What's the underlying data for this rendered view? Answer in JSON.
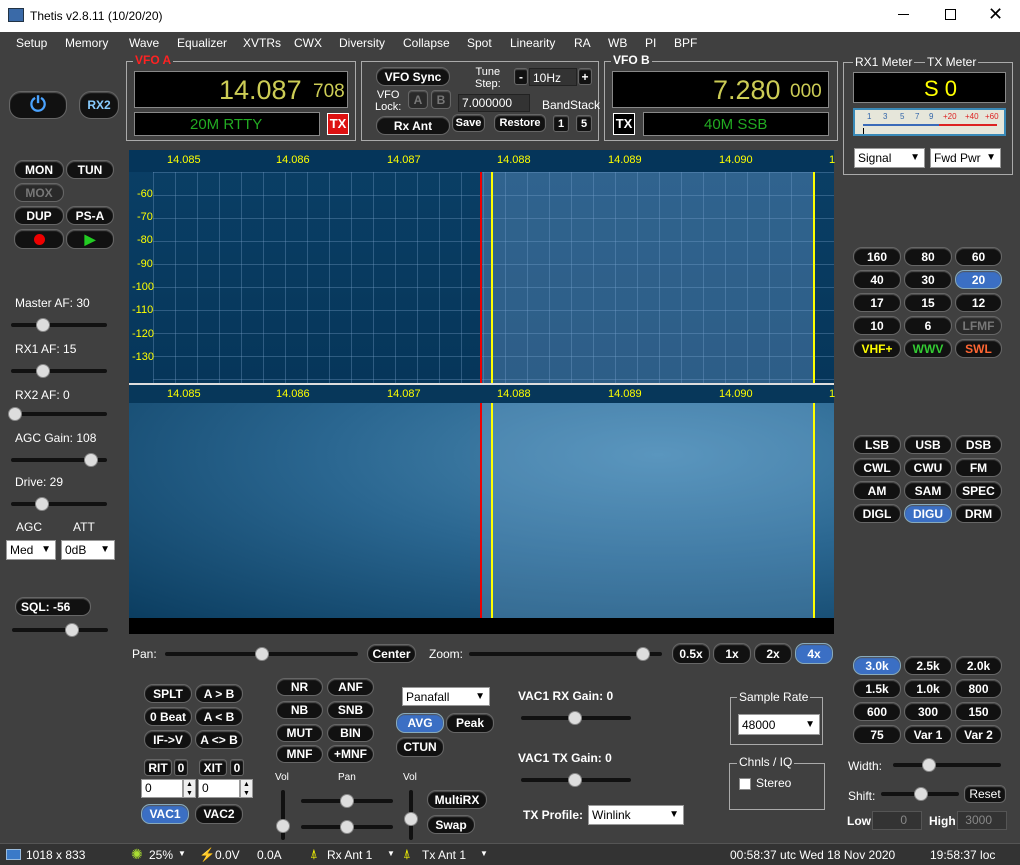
{
  "title": "Thetis v2.8.11 (10/20/20)",
  "menu": [
    "Setup",
    "Memory",
    "Wave",
    "Equalizer",
    "XVTRs",
    "CWX",
    "Diversity",
    "Collapse",
    "Spot",
    "Linearity",
    "RA",
    "WB",
    "PI",
    "BPF"
  ],
  "left": {
    "power_icon": "power-icon",
    "rx2": "RX2",
    "mon": "MON",
    "tun": "TUN",
    "mox": "MOX",
    "dup": "DUP",
    "psa": "PS-A",
    "record_icon": "record-icon",
    "play_icon": "play-icon",
    "master_af": "Master AF:  30",
    "rx1_af": "RX1 AF:  15",
    "rx2_af": "RX2 AF:  0",
    "agc_gain": "AGC Gain:  108",
    "drive": "Drive:  29",
    "agc_label": "AGC",
    "att_label": "ATT",
    "agc_value": "Med",
    "att_value": "0dB",
    "sql": "SQL: -56",
    "levels": {
      "master_af": 30,
      "rx1_af": 15,
      "rx2_af": 0,
      "agc_gain": 108,
      "drive": 29,
      "sql": -56
    }
  },
  "vfoa": {
    "label": "VFO A",
    "freq_main": "14.087",
    "freq_sub": "708",
    "mode": "20M RTTY",
    "tx": "TX"
  },
  "vfo_mid": {
    "vfo_sync": "VFO Sync",
    "tune_step_label": "Tune\nStep:",
    "tune_minus": "-",
    "tune_step": "10Hz",
    "tune_plus": "+",
    "vfo_lock": "VFO\nLock:",
    "lock_a": "A",
    "lock_b": "B",
    "bandstack_freq": "7.000000",
    "bandstack": "BandStack",
    "rx_ant": "Rx Ant",
    "save": "Save",
    "restore": "Restore",
    "bs1": "1",
    "bs5": "5"
  },
  "vfob": {
    "label": "VFO B",
    "freq_main": "7.280",
    "freq_sub": "000",
    "mode": "40M SSB",
    "tx": "TX"
  },
  "meters": {
    "rx1": "RX1 Meter",
    "tx": "TX Meter",
    "value": "S 0",
    "scale": [
      "1",
      "3",
      "5",
      "7",
      "9",
      "+20",
      "+40",
      "+60"
    ],
    "rx_mode": "Signal",
    "tx_mode": "Fwd Pwr"
  },
  "spectrum": {
    "freqs": [
      "14.085",
      "14.086",
      "14.087",
      "14.088",
      "14.089",
      "14.090",
      "1"
    ],
    "dbs": [
      "-60",
      "-70",
      "-80",
      "-90",
      "-100",
      "-110",
      "-120",
      "-130"
    ]
  },
  "pan": {
    "pan_label": "Pan:",
    "center": "Center",
    "zoom_label": "Zoom:",
    "zooms": [
      "0.5x",
      "1x",
      "2x",
      "4x"
    ]
  },
  "bands": [
    "160",
    "80",
    "60",
    "40",
    "30",
    "20",
    "17",
    "15",
    "12",
    "10",
    "6",
    "LFMF",
    "VHF+",
    "WWV",
    "SWL"
  ],
  "modes": [
    "LSB",
    "USB",
    "DSB",
    "CWL",
    "CWU",
    "FM",
    "AM",
    "SAM",
    "SPEC",
    "DIGL",
    "DIGU",
    "DRM"
  ],
  "filters": [
    "3.0k",
    "2.5k",
    "2.0k",
    "1.5k",
    "1.0k",
    "800",
    "600",
    "300",
    "150",
    "75",
    "Var 1",
    "Var 2"
  ],
  "filter_ctrl": {
    "width": "Width:",
    "shift": "Shift:",
    "reset": "Reset",
    "low": "Low",
    "low_val": "0",
    "high": "High",
    "high_val": "3000"
  },
  "bottom": {
    "splt": "SPLT",
    "a_to_b": "A > B",
    "zero_beat": "0 Beat",
    "a_from_b": "A < B",
    "if_v": "IF->V",
    "a_swap_b": "A <> B",
    "rit": "RIT",
    "rit_val": "0",
    "xit": "XIT",
    "xit_val": "0",
    "rit_input": "0",
    "xit_input": "0",
    "vac1": "VAC1",
    "vac2": "VAC2",
    "nr": "NR",
    "anf": "ANF",
    "nb": "NB",
    "snb": "SNB",
    "mut": "MUT",
    "bin": "BIN",
    "mnf": "MNF",
    "pmnf": "+MNF",
    "vol": "Vol",
    "pan": "Pan",
    "vol2": "Vol",
    "display_mode": "Panafall",
    "avg": "AVG",
    "peak": "Peak",
    "ctun": "CTUN",
    "vac1_rx": "VAC1  RX Gain:  0",
    "vac1_tx": "VAC1  TX Gain:  0",
    "tx_profile_label": "TX Profile:",
    "tx_profile": "Winlink",
    "multirx": "MultiRX",
    "swap": "Swap",
    "sample_rate_label": "Sample Rate",
    "sample_rate": "48000",
    "chnls_label": "Chnls / IQ",
    "stereo": "Stereo"
  },
  "status": {
    "size": "1018 x 833",
    "cpu": "25%",
    "volt": "0.0V",
    "amp": "0.0A",
    "rx_ant": "Rx Ant  1",
    "tx_ant": "Tx Ant  1",
    "utc": "00:58:37 utc  Wed 18 Nov 2020",
    "loc": "19:58:37 loc"
  }
}
